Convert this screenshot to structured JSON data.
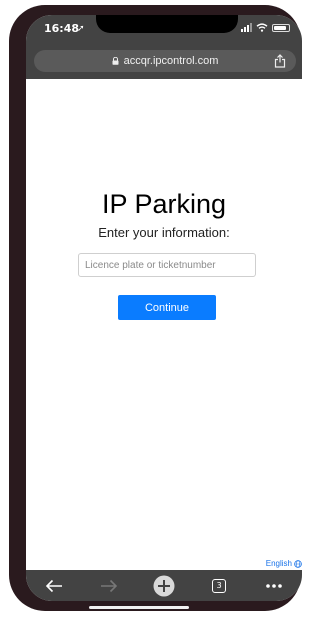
{
  "status_bar": {
    "time": "16:48",
    "location_icon": "location-arrow-icon",
    "signal_icon": "cellular-signal-icon",
    "wifi_icon": "wifi-icon",
    "battery_icon": "battery-icon"
  },
  "browser": {
    "url": "accqr.ipcontrol.com",
    "lock_icon": "lock-icon",
    "share_icon": "share-icon"
  },
  "page": {
    "title": "IP Parking",
    "subtitle": "Enter your information:",
    "input_placeholder": "Licence plate or ticketnumber",
    "input_value": "",
    "continue_label": "Continue",
    "language_label": "English",
    "accent_color": "#0a7cff"
  },
  "toolbar": {
    "back_icon": "back-arrow-icon",
    "forward_icon": "forward-arrow-icon",
    "new_tab_icon": "plus-icon",
    "tab_count": "3",
    "menu_icon": "more-dots-icon"
  }
}
